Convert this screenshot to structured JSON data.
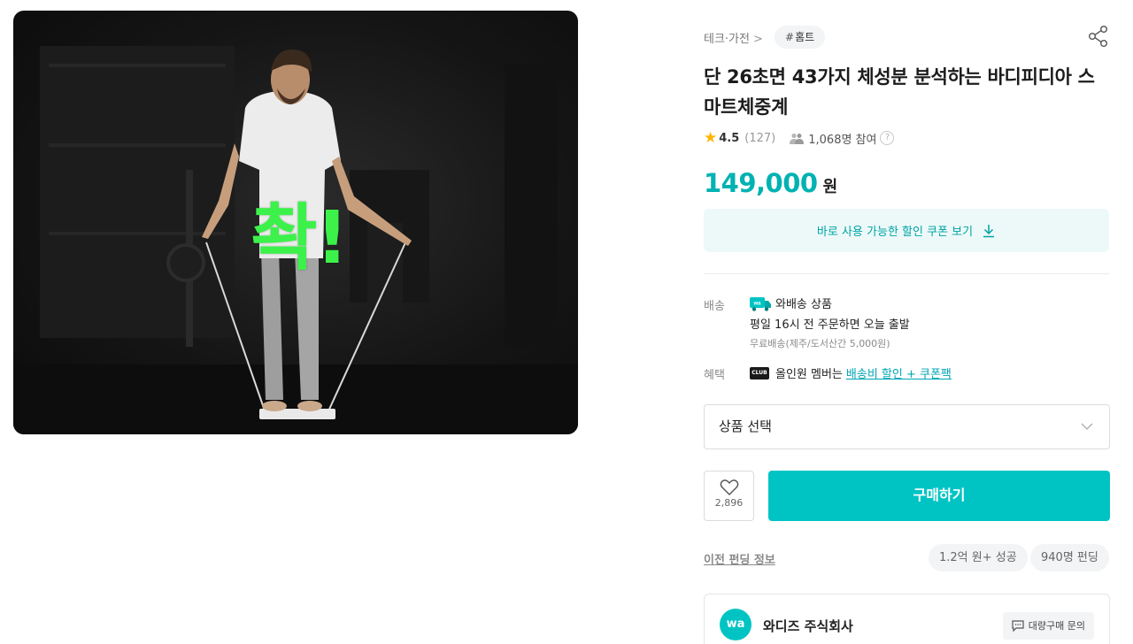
{
  "hero": {
    "overlay_text": "촥!"
  },
  "breadcrumb": {
    "category": "테크·가전",
    "separator": ">",
    "tag_hash": "#",
    "tag": "홈트"
  },
  "product": {
    "title": "단 26초면 43가지 체성분 분석하는 바디피디아 스마트체중계",
    "rating": "4.5",
    "review_count": "(127)",
    "participants": "1,068명 참여",
    "help_glyph": "?",
    "price": "149,000",
    "currency": "원"
  },
  "coupon": {
    "label": "바로 사용 가능한 할인 쿠폰 보기",
    "icon": "download-icon"
  },
  "shipping": {
    "label": "배송",
    "badge": "wa",
    "type": "와배송 상품",
    "dispatch": "평일 16시 전 주문하면 오늘 출발",
    "fee": "무료배송(제주/도서산간 5,000원)"
  },
  "benefit": {
    "label": "혜택",
    "club_badge": "CLUB",
    "text": "올인원 멤버는",
    "link": "배송비 할인 + 쿠폰팩"
  },
  "option_select": {
    "placeholder": "상품 선택"
  },
  "actions": {
    "like_count": "2,896",
    "buy_label": "구매하기"
  },
  "previous_funding": {
    "label": "이전 펀딩 정보",
    "chips": [
      "1.2억 원+ 성공",
      "940명 펀딩"
    ]
  },
  "maker": {
    "logo": "wa",
    "name": "와디즈 주식회사",
    "inquiry": "대량구매 문의"
  },
  "colors": {
    "accent": "#00c4c4",
    "price": "#00b2b2",
    "star": "#ffb400",
    "overlay": "#3cf24a"
  }
}
